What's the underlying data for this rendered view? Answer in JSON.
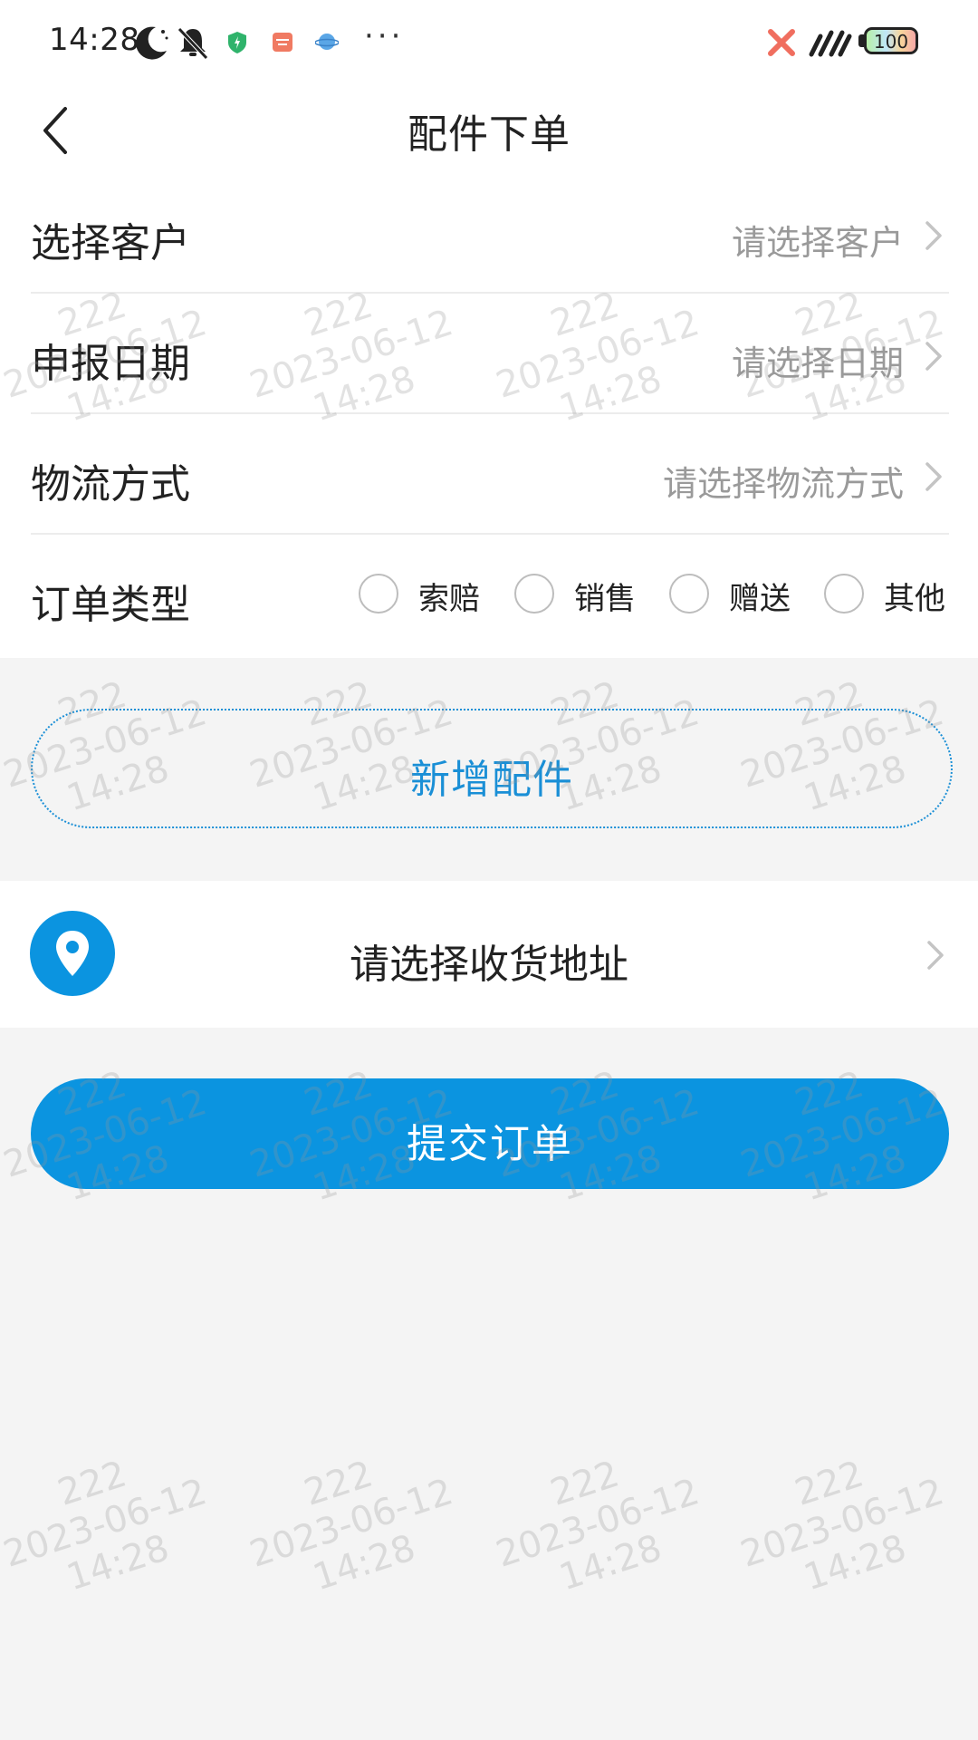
{
  "status_bar": {
    "time": "14:28",
    "battery": "100",
    "more": "···",
    "icons": [
      "moon-icon",
      "mute-icon",
      "shield-icon",
      "calendar-icon",
      "planet-icon",
      "x-icon",
      "signal-icon",
      "battery-icon"
    ]
  },
  "header": {
    "title": "配件下单",
    "back_icon": "chevron-left-icon"
  },
  "form": {
    "customer": {
      "label": "选择客户",
      "placeholder": "请选择客户"
    },
    "date": {
      "label": "申报日期",
      "placeholder": "请选择日期"
    },
    "logistics": {
      "label": "物流方式",
      "placeholder": "请选择物流方式"
    },
    "order_type": {
      "label": "订单类型",
      "options": [
        "索赔",
        "销售",
        "赠送",
        "其他"
      ]
    }
  },
  "add_part": {
    "label": "新增配件"
  },
  "address": {
    "label": "请选择收货地址",
    "icon": "location-pin-icon"
  },
  "submit": {
    "label": "提交订单"
  },
  "watermark": {
    "user": "222",
    "date": "2023-06-12",
    "time": "14:28"
  },
  "colors": {
    "accent": "#0b94e0",
    "background": "#f4f4f4",
    "placeholder": "#9a9a9a"
  }
}
